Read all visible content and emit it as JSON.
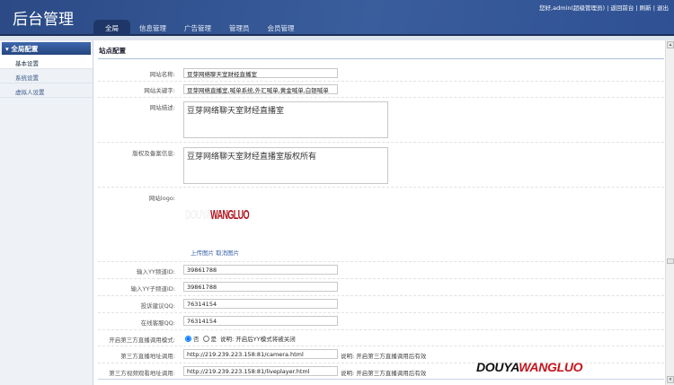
{
  "header": {
    "title": "后台管理",
    "tabs": [
      "全局",
      "信息管理",
      "广告管理",
      "管理员",
      "会员管理"
    ],
    "user_links": "您好,admin(超级管理员) | 返回前台 | 刷新 | 退出"
  },
  "sidebar": {
    "section": "全局配置",
    "items": [
      "基本设置",
      "系统设置",
      "虚拟人设置"
    ]
  },
  "main": {
    "title": "站点配置",
    "site_name": {
      "label": "网站名称:",
      "value": "豆芽网络聊天室财经直播室"
    },
    "keywords": {
      "label": "网站关键字:",
      "value": "豆芽网络直播室,喊单系统,外汇喊单,黄金喊单,白银喊单"
    },
    "description": {
      "label": "网站描述:",
      "value": "豆芽网络聊天室财经直播室"
    },
    "copyright": {
      "label": "版权及备案信息:",
      "value": "豆芽网络聊天室财经直播室版权所有"
    },
    "logo": {
      "label": "网站logo:",
      "logo_text_a": "DOUYA",
      "logo_text_b": "WANGLUO",
      "upload": "上传图片",
      "cancel": "取消图片"
    },
    "yy_channel": {
      "label": "输入YY频道ID:",
      "value": "39861788"
    },
    "yy_sub": {
      "label": "输入YY子频道ID:",
      "value": "39861788"
    },
    "complaint_qq": {
      "label": "投诉建议QQ:",
      "value": "76314154"
    },
    "service_qq": {
      "label": "在线客服QQ:",
      "value": "76314154"
    },
    "mode": {
      "label": "开启第三方直播调用模式:",
      "opt_no": "否",
      "opt_yes": "是",
      "note": "说明: 开启后YY模式将被关闭"
    },
    "live_url": {
      "label": "第三方直播地址调用:",
      "value": "http://219.239.223.158:81/camera.html",
      "note": "说明: 开启第三方直播调用后有效"
    },
    "video_url": {
      "label": "第三方视频观看地址调用:",
      "value": "http://219.239.223.158:81/liveplayer.html",
      "note": "说明: 开启第三方直播调用后有效"
    }
  },
  "watermark": {
    "a": "DOUYA",
    "b": "WANGLUO"
  }
}
